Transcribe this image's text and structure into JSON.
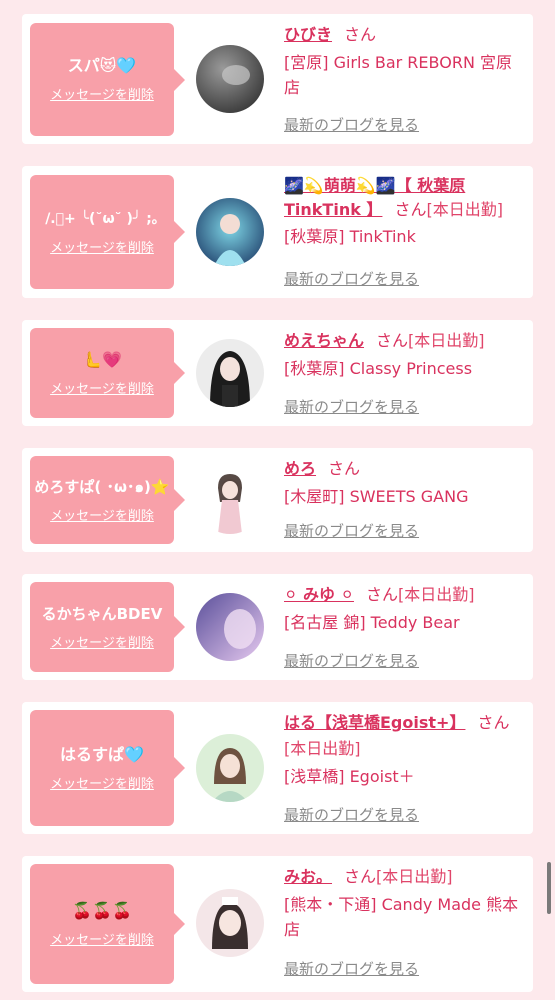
{
  "delete_label": "メッセージを削除",
  "blog_label": "最新のブログを見る",
  "san_label": "さん",
  "colors": {
    "background": "#fde9ec",
    "bubble": "#f8a0a9",
    "accent": "#d9325e",
    "link_gray": "#8a8a8a"
  },
  "entries": [
    {
      "message": "スパ😻🩵",
      "name": "ひびき",
      "badge": "",
      "shop": "[宮原] Girls Bar REBORN 宮原店",
      "avatar_colors": [
        "#9a9a9a",
        "#3a3a3a"
      ]
    },
    {
      "message": "/.ﾟ+ ╰(˘ω˘ )╯ ;｡",
      "name": "🌌💫萌萌💫🌌【 秋葉原 TinkTink 】",
      "badge": "[本日出勤]",
      "shop": "[秋葉原] TinkTink",
      "avatar_colors": [
        "#5fc2d8",
        "#1f3f6a"
      ]
    },
    {
      "message": "🫷💗",
      "name": "めえちゃん",
      "badge": "[本日出勤]",
      "shop": "[秋葉原] Classy Princess",
      "avatar_colors": [
        "#e8e8e8",
        "#202020"
      ]
    },
    {
      "message": "めろすぱ( ･ω･๑)⭐",
      "name": "めろ",
      "badge": "",
      "shop": "[木屋町] SWEETS GANG",
      "avatar_colors": [
        "#ffffff",
        "#f1c9d2"
      ]
    },
    {
      "message": "るかちゃんBDEV",
      "name": "⚪︎ みゆ ⚪︎",
      "badge": "[本日出勤]",
      "shop": "[名古屋 錦] Teddy Bear",
      "avatar_colors": [
        "#c9b2e6",
        "#4a3f80"
      ]
    },
    {
      "message": "はるすぱ🩵",
      "name": "はる【浅草橋Egoist+】",
      "badge": "[本日出勤]",
      "shop": "[浅草橋] Egoist＋",
      "avatar_colors": [
        "#d6e8d2",
        "#7a6050"
      ]
    },
    {
      "message": "🍒🍒🍒",
      "name": "みお。",
      "badge": "[本日出勤]",
      "shop": "[熊本・下通] Candy Made 熊本店",
      "avatar_colors": [
        "#f2e4e6",
        "#3a2e2e"
      ]
    }
  ]
}
